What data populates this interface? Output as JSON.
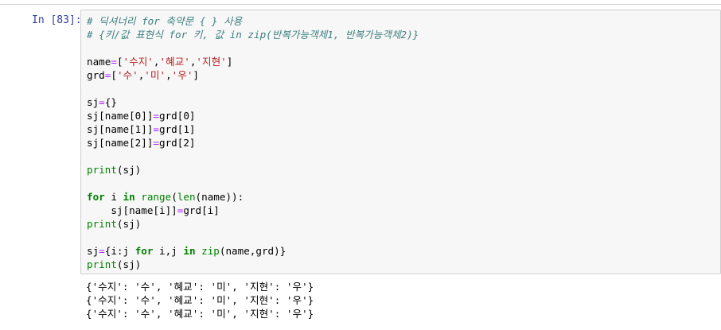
{
  "cell": {
    "prompt": "In [83]:",
    "code_lines": [
      [
        {
          "t": "# 딕셔너리 for 축약문 { } 사용",
          "c": "cm"
        }
      ],
      [
        {
          "t": "# {키/값 표현식 for 키, 값 in zip(반복가능객체1, 반복가능객체2)}",
          "c": "cm"
        }
      ],
      [],
      [
        {
          "t": "name"
        },
        {
          "t": "=",
          "c": "op"
        },
        {
          "t": "["
        },
        {
          "t": "'수지'",
          "c": "st"
        },
        {
          "t": ","
        },
        {
          "t": "'혜교'",
          "c": "st"
        },
        {
          "t": ","
        },
        {
          "t": "'지현'",
          "c": "st"
        },
        {
          "t": "]"
        }
      ],
      [
        {
          "t": "grd"
        },
        {
          "t": "=",
          "c": "op"
        },
        {
          "t": "["
        },
        {
          "t": "'수'",
          "c": "st"
        },
        {
          "t": ","
        },
        {
          "t": "'미'",
          "c": "st"
        },
        {
          "t": ","
        },
        {
          "t": "'우'",
          "c": "st"
        },
        {
          "t": "]"
        }
      ],
      [],
      [
        {
          "t": "sj"
        },
        {
          "t": "=",
          "c": "op"
        },
        {
          "t": "{}"
        }
      ],
      [
        {
          "t": "sj[name[0]]"
        },
        {
          "t": "=",
          "c": "op"
        },
        {
          "t": "grd[0]"
        }
      ],
      [
        {
          "t": "sj[name[1]]"
        },
        {
          "t": "=",
          "c": "op"
        },
        {
          "t": "grd[1]"
        }
      ],
      [
        {
          "t": "sj[name[2]]"
        },
        {
          "t": "=",
          "c": "op"
        },
        {
          "t": "grd[2]"
        }
      ],
      [],
      [
        {
          "t": "print",
          "c": "bi"
        },
        {
          "t": "(sj)"
        }
      ],
      [],
      [
        {
          "t": "for",
          "c": "kw"
        },
        {
          "t": " i "
        },
        {
          "t": "in",
          "c": "kw"
        },
        {
          "t": " "
        },
        {
          "t": "range",
          "c": "bi"
        },
        {
          "t": "("
        },
        {
          "t": "len",
          "c": "bi"
        },
        {
          "t": "(name)):"
        }
      ],
      [
        {
          "t": "    sj[name[i]]"
        },
        {
          "t": "=",
          "c": "op"
        },
        {
          "t": "grd[i]"
        }
      ],
      [
        {
          "t": "print",
          "c": "bi"
        },
        {
          "t": "(sj)"
        }
      ],
      [],
      [
        {
          "t": "sj"
        },
        {
          "t": "=",
          "c": "op"
        },
        {
          "t": "{i:j "
        },
        {
          "t": "for",
          "c": "kw"
        },
        {
          "t": " i,j "
        },
        {
          "t": "in",
          "c": "kw"
        },
        {
          "t": " "
        },
        {
          "t": "zip",
          "c": "bi"
        },
        {
          "t": "(name,grd)}"
        }
      ],
      [
        {
          "t": "print",
          "c": "bi"
        },
        {
          "t": "(sj)"
        }
      ]
    ],
    "output_lines": [
      "{'수지': '수', '혜교': '미', '지현': '우'}",
      "{'수지': '수', '혜교': '미', '지현': '우'}",
      "{'수지': '수', '혜교': '미', '지현': '우'}"
    ]
  },
  "colors": {
    "prompt": "#303f9f",
    "comment": "#408080",
    "keyword": "#008000",
    "string": "#ba2121",
    "operator": "#aa22ff",
    "cell_background": "#f7f7f7",
    "cell_border": "#cfcfcf"
  }
}
